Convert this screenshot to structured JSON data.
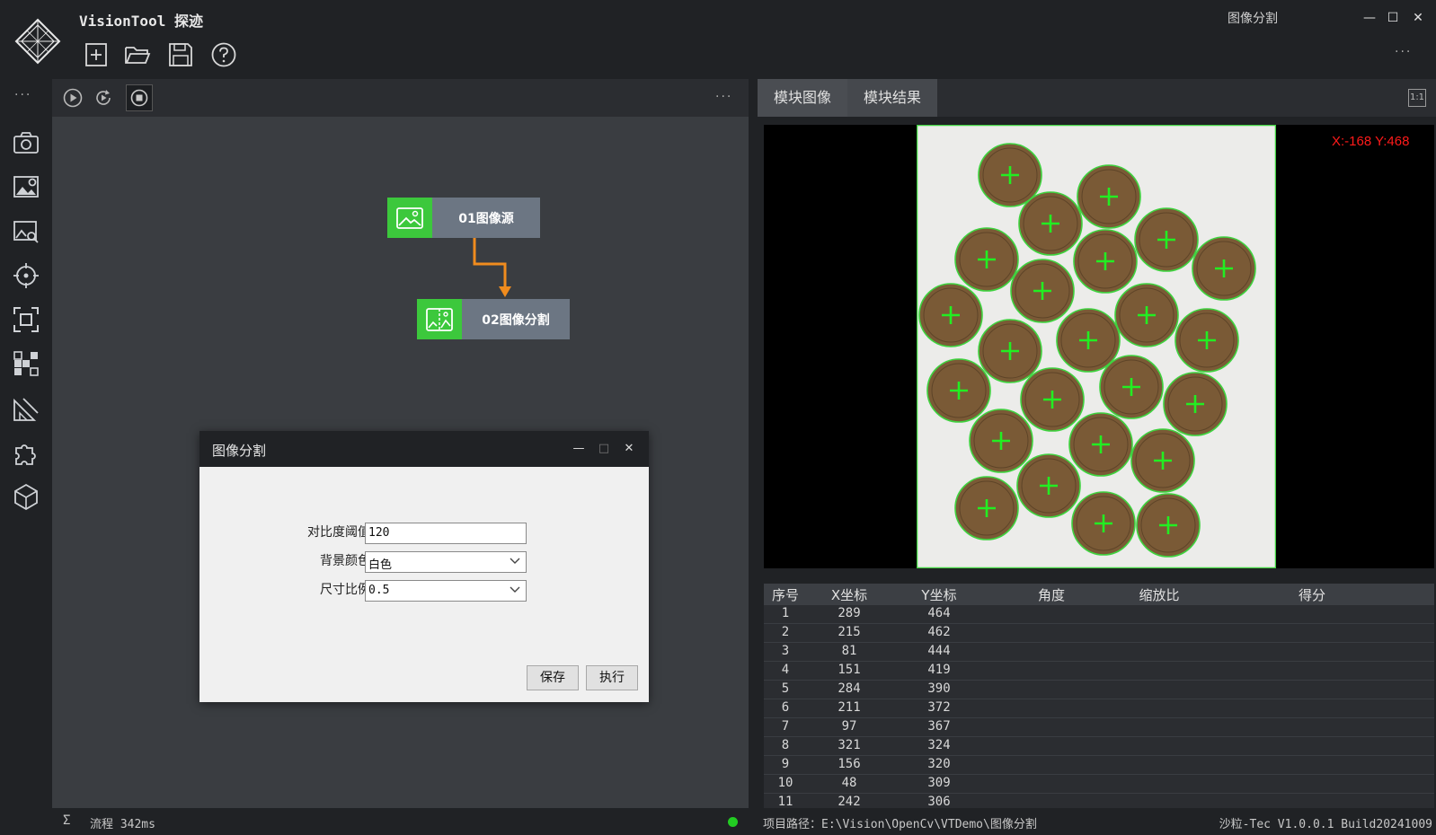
{
  "app": {
    "title": "VisionTool 探迹",
    "window_title": "图像分割",
    "toolbar": [
      "new-file",
      "open-folder",
      "save",
      "help"
    ],
    "more": "···"
  },
  "sidebar": {
    "more": "···",
    "items": [
      "camera",
      "image-settings",
      "image-search",
      "target",
      "focus-frame",
      "pattern",
      "measure",
      "plugin",
      "cube"
    ]
  },
  "center": {
    "toolbar_more": "···",
    "nodes": [
      {
        "label": "01图像源",
        "icon": "image-icon"
      },
      {
        "label": "02图像分割",
        "icon": "split-image-icon"
      }
    ],
    "status": {
      "sigma": "Σ",
      "text": "流程 342ms",
      "dot_color": "#22cc22"
    }
  },
  "dialog": {
    "title": "图像分割",
    "fields": [
      {
        "label": "对比度阈值",
        "value": "120",
        "type": "text"
      },
      {
        "label": "背景颜色",
        "value": "白色",
        "type": "select"
      },
      {
        "label": "尺寸比例",
        "value": "0.5",
        "type": "select"
      }
    ],
    "buttons": {
      "save": "保存",
      "run": "执行"
    },
    "controls": {
      "minimize": "—",
      "maximize": "□",
      "close": "✕"
    }
  },
  "right": {
    "tabs": [
      "模块图像",
      "模块结果"
    ],
    "active_tab": 0,
    "ratio_label": "1:1",
    "coord_readout": "X:-168 Y:468",
    "table": {
      "columns": [
        "序号",
        "X坐标",
        "Y坐标",
        "角度",
        "缩放比",
        "得分"
      ],
      "rows": [
        [
          "1",
          "289",
          "464",
          "",
          "",
          ""
        ],
        [
          "2",
          "215",
          "462",
          "",
          "",
          ""
        ],
        [
          "3",
          "81",
          "444",
          "",
          "",
          ""
        ],
        [
          "4",
          "151",
          "419",
          "",
          "",
          ""
        ],
        [
          "5",
          "284",
          "390",
          "",
          "",
          ""
        ],
        [
          "6",
          "211",
          "372",
          "",
          "",
          ""
        ],
        [
          "7",
          "97",
          "367",
          "",
          "",
          ""
        ],
        [
          "8",
          "321",
          "324",
          "",
          "",
          ""
        ],
        [
          "9",
          "156",
          "320",
          "",
          "",
          ""
        ],
        [
          "10",
          "48",
          "309",
          "",
          "",
          ""
        ],
        [
          "11",
          "242",
          "306",
          "",
          "",
          ""
        ]
      ]
    },
    "status": {
      "path": "项目路径：E:\\Vision\\OpenCv\\VTDemo\\图像分割",
      "version": "沙粒-Tec V1.0.0.1 Build20241009"
    }
  },
  "colors": {
    "accent_green": "#3cc83c",
    "node_gray": "#6c7683",
    "arrow": "#f08c1e",
    "crosshair": "#22ee22",
    "coin_outline": "#3fd23f"
  }
}
